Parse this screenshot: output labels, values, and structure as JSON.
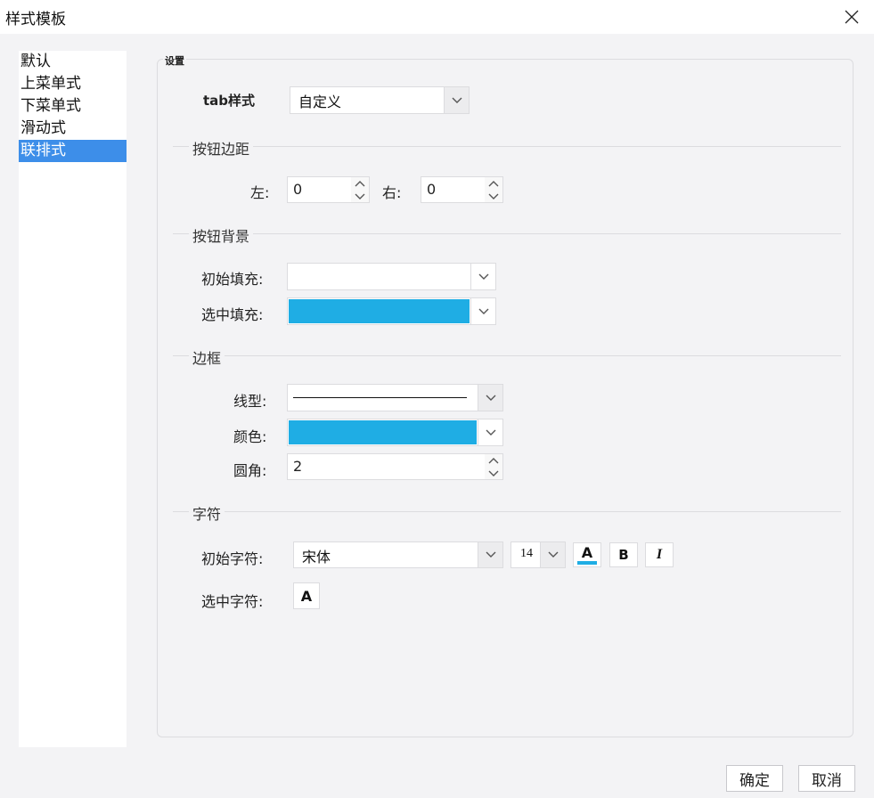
{
  "window": {
    "title": "样式模板"
  },
  "sidebar": {
    "items": [
      {
        "label": "默认"
      },
      {
        "label": "上菜单式"
      },
      {
        "label": "下菜单式"
      },
      {
        "label": "滑动式"
      },
      {
        "label": "联排式"
      }
    ],
    "active_label": "联排式"
  },
  "panel": {
    "legend": "设置"
  },
  "tab_style": {
    "label": "tab样式",
    "value": "自定义"
  },
  "button_margin": {
    "section": "按钮边距",
    "left_label": "左:",
    "left_value": "0",
    "right_label": "右:",
    "right_value": "0"
  },
  "button_background": {
    "section": "按钮背景",
    "initial_fill_label": "初始填充:",
    "initial_fill_color": "#ffffff",
    "selected_fill_label": "选中填充:",
    "selected_fill_color": "#1fade4"
  },
  "border": {
    "section": "边框",
    "line_type_label": "线型:",
    "color_label": "颜色:",
    "color_value": "#1fade4",
    "radius_label": "圆角:",
    "radius_value": "2"
  },
  "characters": {
    "section": "字符",
    "initial_label": "初始字符:",
    "font_value": "宋体",
    "size_value": "14",
    "bold_glyph": "B",
    "italic_glyph": "I",
    "color_glyph": "A",
    "font_color_bar": "#1fade4",
    "selected_label": "选中字符:"
  },
  "footer": {
    "ok_label": "确定",
    "cancel_label": "取消"
  }
}
